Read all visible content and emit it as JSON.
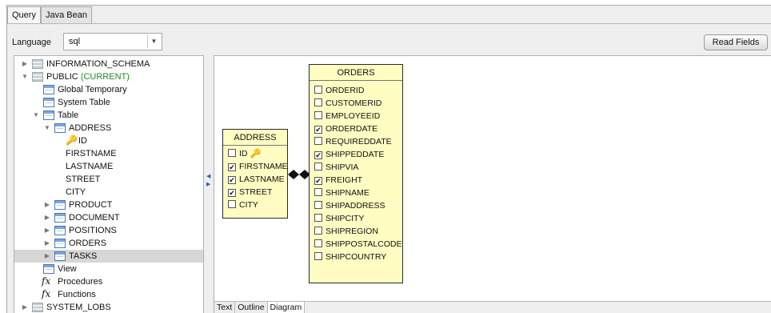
{
  "tabs": [
    {
      "label": "Query",
      "active": true
    },
    {
      "label": "Java Bean",
      "active": false
    }
  ],
  "language": {
    "label": "Language",
    "value": "sql"
  },
  "read_fields_label": "Read Fields",
  "tree": [
    {
      "label": "INFORMATION_SCHEMA",
      "icon": "schema-icon",
      "toggle": "collapsed"
    },
    {
      "label": "PUBLIC",
      "suffix": "(CURRENT)",
      "icon": "schema-icon",
      "toggle": "expanded"
    },
    {
      "label": "Global Temporary",
      "icon": "table-icon"
    },
    {
      "label": "System Table",
      "icon": "table-icon"
    },
    {
      "label": "Table",
      "icon": "table-icon",
      "toggle": "expanded"
    },
    {
      "label": "ADDRESS",
      "icon": "table-icon",
      "toggle": "expanded"
    },
    {
      "label": "ID",
      "icon": "key-icon"
    },
    {
      "label": "FIRSTNAME"
    },
    {
      "label": "LASTNAME"
    },
    {
      "label": "STREET"
    },
    {
      "label": "CITY"
    },
    {
      "label": "PRODUCT",
      "icon": "table-icon",
      "toggle": "collapsed"
    },
    {
      "label": "DOCUMENT",
      "icon": "table-icon",
      "toggle": "collapsed"
    },
    {
      "label": "POSITIONS",
      "icon": "table-icon",
      "toggle": "collapsed"
    },
    {
      "label": "ORDERS",
      "icon": "table-icon",
      "toggle": "collapsed"
    },
    {
      "label": "TASKS",
      "icon": "table-icon",
      "toggle": "collapsed",
      "selected": true
    },
    {
      "label": "View",
      "icon": "table-icon"
    },
    {
      "label": "Procedures",
      "icon": "fx-icon"
    },
    {
      "label": "Functions",
      "icon": "fx-icon"
    },
    {
      "label": "SYSTEM_LOBS",
      "icon": "schema-icon",
      "toggle": "collapsed"
    }
  ],
  "address_entity": {
    "title": "ADDRESS",
    "fields": [
      {
        "name": "ID",
        "checked": false,
        "key": true
      },
      {
        "name": "FIRSTNAME",
        "checked": true
      },
      {
        "name": "LASTNAME",
        "checked": true
      },
      {
        "name": "STREET",
        "checked": true
      },
      {
        "name": "CITY",
        "checked": false
      }
    ]
  },
  "orders_entity": {
    "title": "ORDERS",
    "fields": [
      {
        "name": "ORDERID",
        "checked": false
      },
      {
        "name": "CUSTOMERID",
        "checked": false
      },
      {
        "name": "EMPLOYEEID",
        "checked": false
      },
      {
        "name": "ORDERDATE",
        "checked": true
      },
      {
        "name": "REQUIREDDATE",
        "checked": false
      },
      {
        "name": "SHIPPEDDATE",
        "checked": true
      },
      {
        "name": "SHIPVIA",
        "checked": false
      },
      {
        "name": "FREIGHT",
        "checked": true
      },
      {
        "name": "SHIPNAME",
        "checked": false
      },
      {
        "name": "SHIPADDRESS",
        "checked": false
      },
      {
        "name": "SHIPCITY",
        "checked": false
      },
      {
        "name": "SHIPREGION",
        "checked": false
      },
      {
        "name": "SHIPPOSTALCODE",
        "checked": false
      },
      {
        "name": "SHIPCOUNTRY",
        "checked": false
      }
    ]
  },
  "bottom_tabs": [
    {
      "label": "Text",
      "active": false
    },
    {
      "label": "Outline",
      "active": false
    },
    {
      "label": "Diagram",
      "active": true
    }
  ],
  "colors": {
    "entity_fill": "#fffdc2",
    "current_label": "#1d8a1d",
    "selected_row": "#d7d7d7"
  }
}
